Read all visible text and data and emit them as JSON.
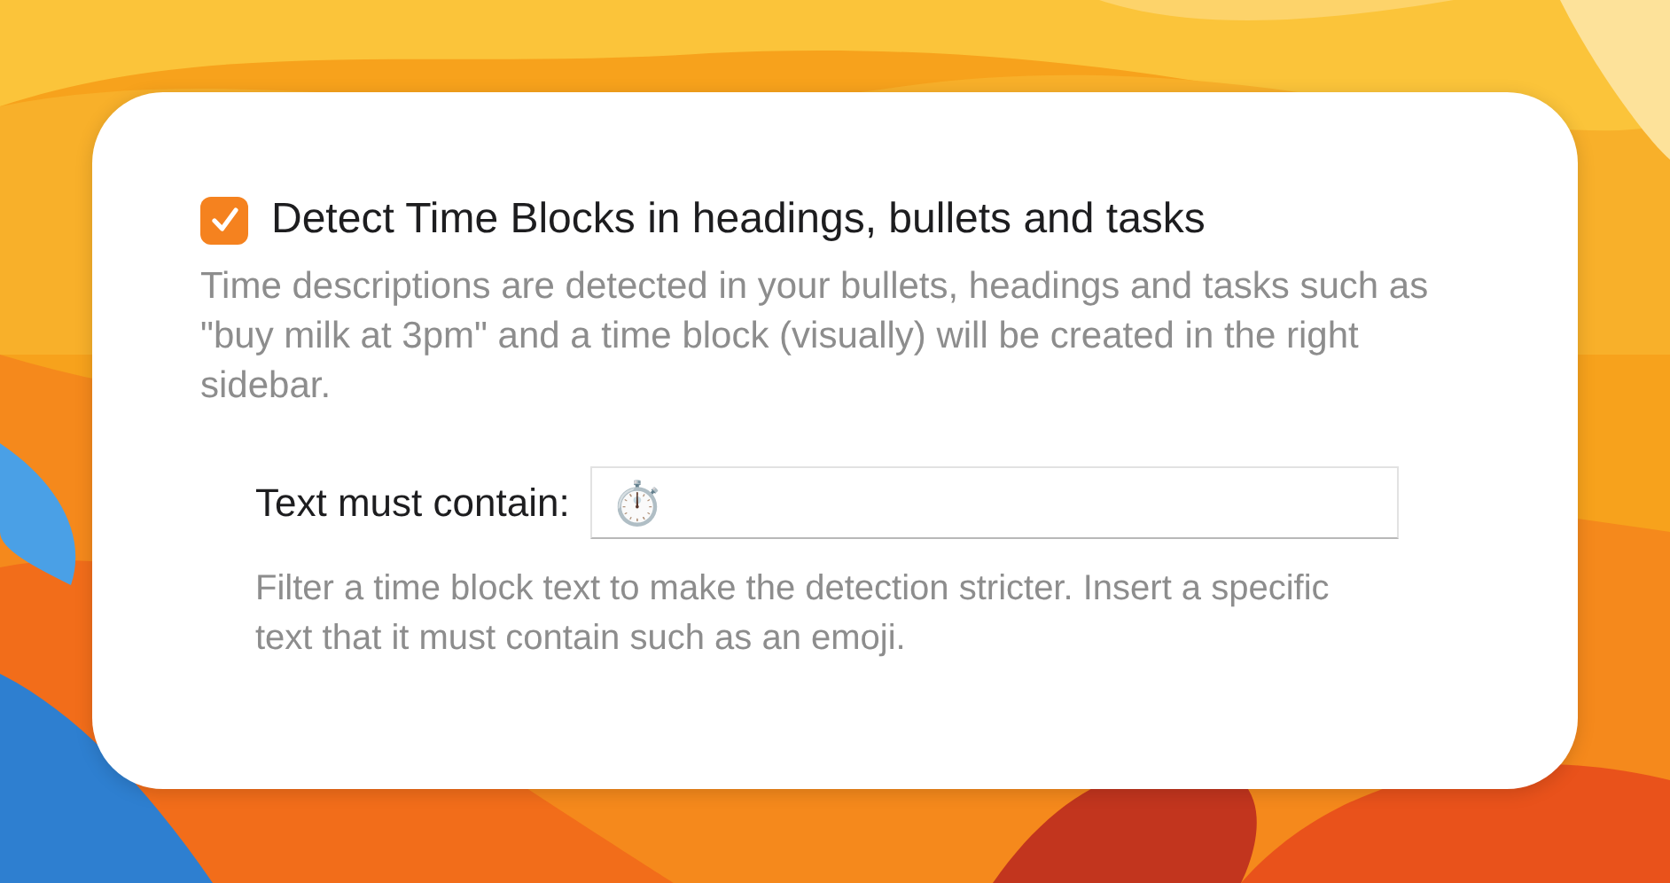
{
  "option": {
    "label": "Detect Time Blocks in headings, bullets and tasks",
    "checked": true,
    "description": "Time descriptions are detected in your bullets, headings and tasks such as \"buy milk at 3pm\" and a time block (visually) will be created in the right sidebar."
  },
  "filter": {
    "label": "Text must contain:",
    "value": "⏱️",
    "description": "Filter a time block text to make the detection stricter. Insert a specific text that it must contain such as an emoji."
  }
}
